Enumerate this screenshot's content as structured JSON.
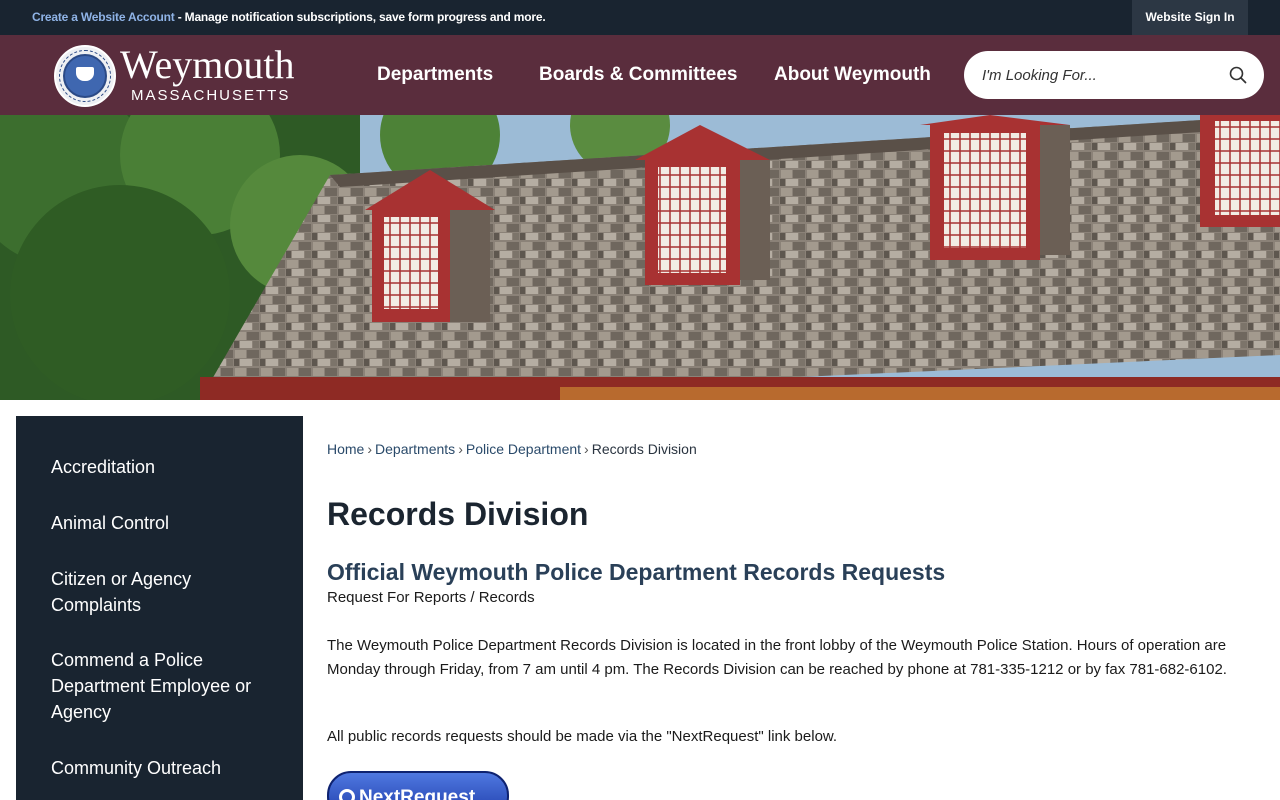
{
  "topbar": {
    "account_link": "Create a Website Account",
    "account_desc": " - Manage notification subscriptions, save form progress and more.",
    "signin_label": "Website Sign In"
  },
  "header": {
    "logo_name": "Weymouth",
    "logo_state": "MASSACHUSETTS",
    "nav": [
      "Departments",
      "Boards & Committees",
      "About Weymouth"
    ],
    "search_placeholder": "I'm Looking For..."
  },
  "sidebar": {
    "items": [
      "Accreditation",
      "Animal Control",
      "Citizen or Agency Complaints",
      "Commend a Police Department Employee or Agency",
      "Community Outreach"
    ]
  },
  "breadcrumb": [
    "Home",
    "Departments",
    "Police Department",
    "Records Division"
  ],
  "page": {
    "title": "Records Division",
    "subheading": "Official Weymouth Police Department Records Requests",
    "subline": "Request For Reports / Records",
    "paragraph1": "The Weymouth Police Department Records Division is located in the front lobby of the Weymouth Police Station. Hours of operation are Monday through Friday, from 7 am until 4 pm. The Records Division can be reached by phone at 781-335-1212 or by fax 781-682-6102.",
    "paragraph2": "All public records requests should be made via the \"NextRequest\" link below.",
    "nextrequest_label": "NextRequest"
  },
  "colors": {
    "topbar": "#192430",
    "header": "#5a2d3d",
    "sidebar": "#192430",
    "link": "#2a4a6a"
  }
}
